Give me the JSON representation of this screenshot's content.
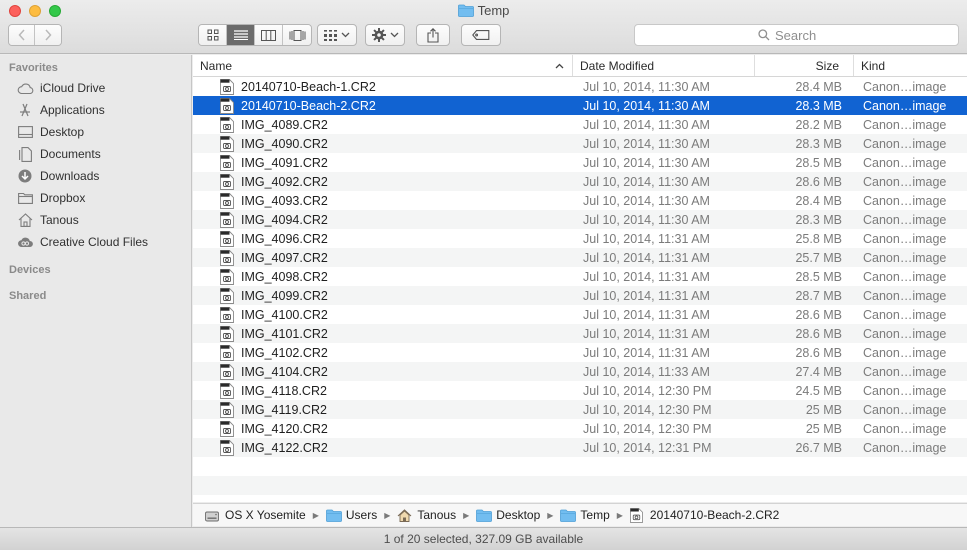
{
  "window": {
    "title": "Temp"
  },
  "toolbar": {
    "search_placeholder": "Search",
    "view_buttons": [
      "icon-view",
      "list-view",
      "column-view",
      "coverflow-view"
    ],
    "active_view": "list-view"
  },
  "sidebar": {
    "sections": [
      {
        "title": "Favorites"
      },
      {
        "title": "Devices"
      },
      {
        "title": "Shared"
      }
    ],
    "favorites": [
      {
        "label": "iCloud Drive",
        "icon": "cloud-icon"
      },
      {
        "label": "Applications",
        "icon": "applications-icon"
      },
      {
        "label": "Desktop",
        "icon": "desktop-icon"
      },
      {
        "label": "Documents",
        "icon": "documents-icon"
      },
      {
        "label": "Downloads",
        "icon": "downloads-icon"
      },
      {
        "label": "Dropbox",
        "icon": "folder-icon"
      },
      {
        "label": "Tanous",
        "icon": "home-icon"
      },
      {
        "label": "Creative Cloud Files",
        "icon": "creative-cloud-icon"
      }
    ]
  },
  "columns": {
    "name": "Name",
    "date": "Date Modified",
    "size": "Size",
    "kind": "Kind"
  },
  "files": [
    {
      "name": "20140710-Beach-1.CR2",
      "date": "Jul 10, 2014, 11:30 AM",
      "size": "28.4 MB",
      "kind": "Canon…image",
      "selected": false
    },
    {
      "name": "20140710-Beach-2.CR2",
      "date": "Jul 10, 2014, 11:30 AM",
      "size": "28.3 MB",
      "kind": "Canon…image",
      "selected": true
    },
    {
      "name": "IMG_4089.CR2",
      "date": "Jul 10, 2014, 11:30 AM",
      "size": "28.2 MB",
      "kind": "Canon…image",
      "selected": false
    },
    {
      "name": "IMG_4090.CR2",
      "date": "Jul 10, 2014, 11:30 AM",
      "size": "28.3 MB",
      "kind": "Canon…image",
      "selected": false
    },
    {
      "name": "IMG_4091.CR2",
      "date": "Jul 10, 2014, 11:30 AM",
      "size": "28.5 MB",
      "kind": "Canon…image",
      "selected": false
    },
    {
      "name": "IMG_4092.CR2",
      "date": "Jul 10, 2014, 11:30 AM",
      "size": "28.6 MB",
      "kind": "Canon…image",
      "selected": false
    },
    {
      "name": "IMG_4093.CR2",
      "date": "Jul 10, 2014, 11:30 AM",
      "size": "28.4 MB",
      "kind": "Canon…image",
      "selected": false
    },
    {
      "name": "IMG_4094.CR2",
      "date": "Jul 10, 2014, 11:30 AM",
      "size": "28.3 MB",
      "kind": "Canon…image",
      "selected": false
    },
    {
      "name": "IMG_4096.CR2",
      "date": "Jul 10, 2014, 11:31 AM",
      "size": "25.8 MB",
      "kind": "Canon…image",
      "selected": false
    },
    {
      "name": "IMG_4097.CR2",
      "date": "Jul 10, 2014, 11:31 AM",
      "size": "25.7 MB",
      "kind": "Canon…image",
      "selected": false
    },
    {
      "name": "IMG_4098.CR2",
      "date": "Jul 10, 2014, 11:31 AM",
      "size": "28.5 MB",
      "kind": "Canon…image",
      "selected": false
    },
    {
      "name": "IMG_4099.CR2",
      "date": "Jul 10, 2014, 11:31 AM",
      "size": "28.7 MB",
      "kind": "Canon…image",
      "selected": false
    },
    {
      "name": "IMG_4100.CR2",
      "date": "Jul 10, 2014, 11:31 AM",
      "size": "28.6 MB",
      "kind": "Canon…image",
      "selected": false
    },
    {
      "name": "IMG_4101.CR2",
      "date": "Jul 10, 2014, 11:31 AM",
      "size": "28.6 MB",
      "kind": "Canon…image",
      "selected": false
    },
    {
      "name": "IMG_4102.CR2",
      "date": "Jul 10, 2014, 11:31 AM",
      "size": "28.6 MB",
      "kind": "Canon…image",
      "selected": false
    },
    {
      "name": "IMG_4104.CR2",
      "date": "Jul 10, 2014, 11:33 AM",
      "size": "27.4 MB",
      "kind": "Canon…image",
      "selected": false
    },
    {
      "name": "IMG_4118.CR2",
      "date": "Jul 10, 2014, 12:30 PM",
      "size": "24.5 MB",
      "kind": "Canon…image",
      "selected": false
    },
    {
      "name": "IMG_4119.CR2",
      "date": "Jul 10, 2014, 12:30 PM",
      "size": "25 MB",
      "kind": "Canon…image",
      "selected": false
    },
    {
      "name": "IMG_4120.CR2",
      "date": "Jul 10, 2014, 12:30 PM",
      "size": "25 MB",
      "kind": "Canon…image",
      "selected": false
    },
    {
      "name": "IMG_4122.CR2",
      "date": "Jul 10, 2014, 12:31 PM",
      "size": "26.7 MB",
      "kind": "Canon…image",
      "selected": false
    }
  ],
  "path": [
    {
      "label": "OS X Yosemite",
      "icon": "drive-icon"
    },
    {
      "label": "Users",
      "icon": "folder-icon"
    },
    {
      "label": "Tanous",
      "icon": "home-icon"
    },
    {
      "label": "Desktop",
      "icon": "folder-icon"
    },
    {
      "label": "Temp",
      "icon": "folder-icon"
    },
    {
      "label": "20140710-Beach-2.CR2",
      "icon": "file-icon"
    }
  ],
  "status": {
    "text": "1 of 20 selected, 327.09 GB available"
  },
  "colors": {
    "selection": "#1163d2",
    "folder": "#6cb8ec"
  }
}
